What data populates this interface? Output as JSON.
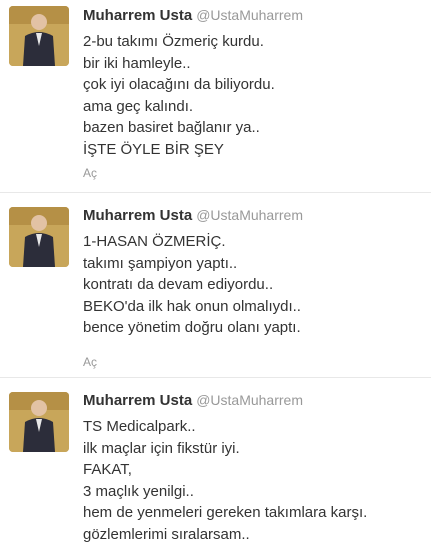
{
  "tweets": [
    {
      "author": {
        "fullname": "Muharrem Usta",
        "username": "@UstaMuharrem"
      },
      "lines": [
        "2-bu takımı Özmeriç kurdu.",
        "bir iki hamleyle..",
        "çok iyi olacağını da biliyordu.",
        "ama geç kalındı.",
        "bazen basiret bağlanır ya..",
        "İŞTE ÖYLE BİR ŞEY"
      ],
      "action": "Aç"
    },
    {
      "author": {
        "fullname": "Muharrem Usta",
        "username": "@UstaMuharrem"
      },
      "lines": [
        "1-HASAN ÖZMERİÇ.",
        "takımı şampiyon yaptı..",
        "kontratı da devam ediyordu..",
        "BEKO'da ilk hak onun olmalıydı..",
        "bence yönetim doğru olanı yaptı."
      ],
      "action": "Aç"
    },
    {
      "author": {
        "fullname": "Muharrem Usta",
        "username": "@UstaMuharrem"
      },
      "lines": [
        "TS Medicalpark..",
        "ilk maçlar için fikstür iyi.",
        "FAKAT,",
        "3 maçlık yenilgi..",
        "hem de yenmeleri gereken takımlara karşı.",
        "gözlemlerimi sıralarsam.."
      ]
    }
  ]
}
